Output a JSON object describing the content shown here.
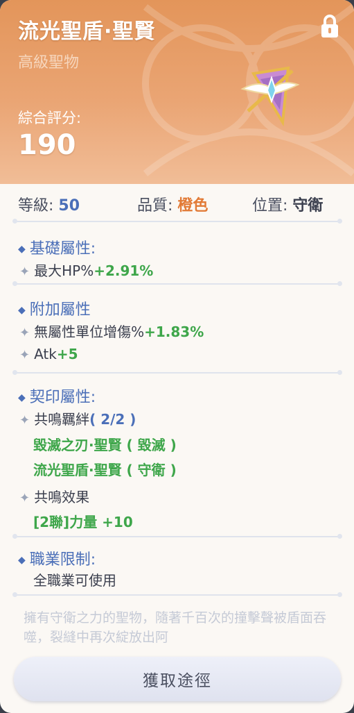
{
  "header": {
    "item_name": "流光聖盾·聖賢",
    "item_type": "高級聖物",
    "score_label": "綜合評分:",
    "score_value": "190",
    "lock_icon": "lock-icon",
    "colors": {
      "header_top": "#e3955a",
      "header_bottom": "#f1bd97"
    }
  },
  "info": {
    "level_label": "等級:",
    "level_value": "50",
    "quality_label": "品質:",
    "quality_value": "橙色",
    "position_label": "位置:",
    "position_value": "守衛"
  },
  "base_attrs": {
    "title": "基礎屬性:",
    "items": [
      {
        "name": "最大HP%",
        "value": "+2.91%"
      }
    ]
  },
  "extra_attrs": {
    "title": "附加屬性",
    "items": [
      {
        "name": "無屬性單位增傷%",
        "value": "+1.83%"
      },
      {
        "name": "Atk",
        "value": "+5"
      }
    ]
  },
  "seal_attrs": {
    "title": "契印屬性:",
    "bond_label": "共鳴羈絆",
    "bond_count": "( 2/2 )",
    "bond_items": [
      "毀滅之刃·聖賢 ( 毀滅 )",
      "流光聖盾·聖賢 ( 守衛 )"
    ],
    "effect_label": "共鳴效果",
    "effect_text": "[2聯]力量 +10"
  },
  "job_limit": {
    "title": "職業限制:",
    "text": "全職業可使用"
  },
  "description": "擁有守衛之力的聖物，隨著千百次的撞擊聲被盾面吞噬，裂縫中再次綻放出阿",
  "acquire_button": "獲取途徑"
}
